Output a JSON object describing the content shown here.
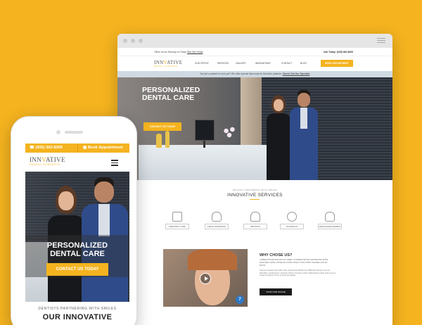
{
  "desktop": {
    "topbar": {
      "hours_text": "Office Hours Monday to Friday",
      "hours_link": "See Our Hours",
      "call_text": "Call Today: (925) 362-8209"
    },
    "logo": {
      "name_a": "INN",
      "name_b": "V",
      "name_c": "ATIVE",
      "tagline": "DENTAL CONCEPTS"
    },
    "nav": [
      "OUR OFFICE",
      "SERVICES",
      "GALLERY",
      "INNOVATIONS",
      "CONTACT",
      "BLOG"
    ],
    "book_button": "BOOK APPOINTMENT",
    "promo": {
      "text": "Not yet a patient of ours yet? We offer special discounts for first time patients.",
      "link": "Check Out Our Specials"
    },
    "hero": {
      "headline_1": "PERSONALIZED",
      "headline_2": "DENTAL CARE",
      "cta": "CONTACT US TODAY"
    },
    "services": {
      "kicker": "PROUDLY PARTNERING WITH SMILES",
      "title": "INNOVATIVE SERVICES",
      "items": [
        "PEDIATRIC CARE",
        "TEETH WHITENING",
        "IMPLANTS",
        "INVISALIGN",
        "SMILE ENHANCEMENT"
      ]
    },
    "why": {
      "title": "WHY CHOSE US?",
      "subtitle": "LOREM IPSUM DOLOR SIT AMET, CONSECTETUR ADIPISCING DUIS NAM NEC NUNC VITAE EU NUNC NIGHT VOLUTPAT PHASELLUS ET NUNC",
      "body": "Vivamus posuere felis ullam quis mauris justo efficitur leo. Blahnidt interdum nunc at bibendum condimentum. Quisque dictum interdum mollis. Pellentesque patrie velit ut purus ornare id aucitus. Proin sit amet ulis aliquet.",
      "button": "TOUR OUR OFFICE",
      "badge": "7"
    },
    "colors": {
      "accent": "#f4b31f",
      "promo_bg": "#cfdae2",
      "dark": "#1a1a1a"
    }
  },
  "mobile": {
    "phone_number": "(925) 362-8209",
    "book_label": "Book Appointment",
    "logo": {
      "name_a": "INN",
      "name_b": "V",
      "name_c": "ATIVE",
      "tagline": "DENTAL CONCEPTS"
    },
    "hero": {
      "headline_1": "PERSONALIZED",
      "headline_2": "DENTAL CARE",
      "cta": "CONTACT US TODAY"
    },
    "kicker": "DENTISTS PARTNERING WITH SMILES",
    "section_title": "OUR INNOVATIVE"
  }
}
